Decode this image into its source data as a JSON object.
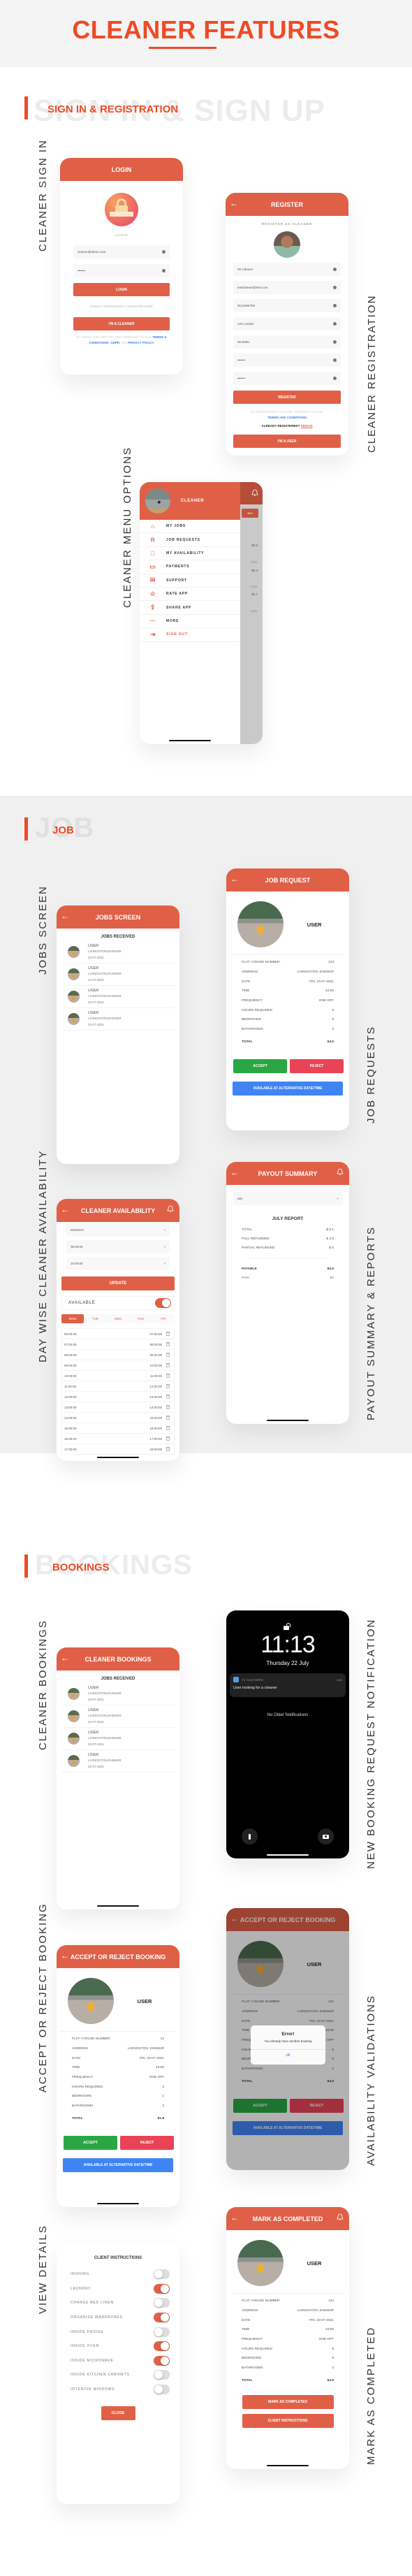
{
  "page": {
    "title": "CLEANER FEATURES"
  },
  "colors": {
    "accent": "#f04a25",
    "header": "#e06047",
    "accept": "#2aa744",
    "reject": "#ea4356",
    "alternative": "#3f84f5"
  },
  "sections": {
    "signin": {
      "label": "SIGN IN & REGISTRATION",
      "ghost": "SIGN IN & SIGN UP"
    },
    "job": {
      "label": "JOB",
      "ghost": "JOB"
    },
    "bookings": {
      "label": "BOOKINGS",
      "ghost": "BOOKINGS"
    }
  },
  "captions": {
    "signin": "CLEANER SIGN IN",
    "registration": "CLEANER REGISTRATION",
    "menu": "CLEANER MENU OPTIONS",
    "jobs_screen": "JOBS SCREEN",
    "job_requests": "JOB REQUESTS",
    "availability": "DAY WISE CLEANER AVAILABILITY",
    "payout": "PAYOUT SUMMARY & REPORTS",
    "bookings": "CLEANER BOOKINGS",
    "notification": "NEW BOOKING REQUEST NOTIFICATION",
    "accept_reject": "ACCEPT OR REJECT BOOKING",
    "validations": "AVAILABILITY VALIDATIONS",
    "view_details": "VIEW DETAILS",
    "mark_completed": "MARK AS COMPLETED"
  },
  "login": {
    "header": "LOGIN",
    "icon_label": "LOGIN",
    "email": "cleaner@demo.com",
    "password": "•••••••",
    "login_button": "LOGIN",
    "forgot": "FORGOT PASSWORD?",
    "separator": "|",
    "register_here": "REGISTER HERE",
    "cleaner_button": "I'M A CLEANER",
    "terms_prefix": "BY USING THIS APP YOU ARE AGREEING TO OUR",
    "terms_link": "TERMS & CONDITIONS",
    "gdpr_link": "GDPR",
    "and": "AND",
    "privacy_link": "PRIVACY POLICY"
  },
  "register": {
    "header": "REGISTER",
    "subtitle": "REGISTER AS CLEANER",
    "fields": [
      "Mr Cleaner",
      "testcleaner@test.com",
      "0123456789",
      "123 London",
      "W1306U",
      "•••••••",
      "•••••••"
    ],
    "register_button": "REGISTER",
    "terms_prefix": "BY REGISTERING YOU ARE AGREEING TO OUR",
    "terms_link": "TERMS AND CONDITIONS",
    "already": "ALREADY REGISTERED?",
    "signin_link": "SIGN IN",
    "user_button": "I'M A USER"
  },
  "menu": {
    "profile_name": "CLEANER",
    "items": [
      {
        "label": "MY JOBS",
        "icon": "home-icon"
      },
      {
        "label": "JOB REQUESTS",
        "icon": "bell-icon"
      },
      {
        "label": "MY AVAILABILITY",
        "icon": "calendar-icon"
      },
      {
        "label": "PAYMENTS",
        "icon": "wallet-icon"
      },
      {
        "label": "SUPPORT",
        "icon": "mail-icon"
      },
      {
        "label": "RATE APP",
        "icon": "star-icon"
      },
      {
        "label": "SHARE APP",
        "icon": "share-icon"
      },
      {
        "label": "MORE",
        "icon": "more-icon"
      },
      {
        "label": "SIGN OUT",
        "icon": "signout-icon"
      }
    ],
    "behind": {
      "tab": "ING",
      "prices": [
        "$4.5",
        "$5.4",
        "$2.7"
      ],
      "times": [
        "07:00",
        "07:00",
        "13:00"
      ]
    }
  },
  "jobs_screen": {
    "header": "JOBS SCREEN",
    "subtitle": "JOBS RECEIVED",
    "items": [
      {
        "name": "USER",
        "address": "LIVINGSTON,EH548JR",
        "date": "23-07-2021"
      },
      {
        "name": "USER",
        "address": "LIVINGSTON,EH548JR",
        "date": "22-07-2021"
      },
      {
        "name": "USER",
        "address": "LIVINGSTON,EH548JR",
        "date": "22-07-2021"
      },
      {
        "name": "USER",
        "address": "LIVINGSTON,EH548JR",
        "date": "22-07-2021"
      }
    ]
  },
  "job_request": {
    "header": "JOB REQUEST",
    "user": "USER",
    "rows": [
      {
        "label": "FLAT / HOUSE NUMBER.",
        "value": "123"
      },
      {
        "label": "ADDRESS",
        "value": "LIVINGSTON, EH548JR"
      },
      {
        "label": "DATE",
        "value": "FRI, 23-07-2021"
      },
      {
        "label": "TIME",
        "value": "10:00"
      },
      {
        "label": "FREQUENCY",
        "value": "ONE OFF"
      },
      {
        "label": "HOURS REQUIRED",
        "value": "5"
      },
      {
        "label": "BEDROOMS",
        "value": "8"
      },
      {
        "label": "BATHROOMS",
        "value": "3"
      }
    ],
    "total_label": "TOTAL",
    "total_value": "$4.5",
    "accept": "ACCEPT",
    "reject": "REJECT",
    "alternative": "AVAILABLE AT ALTERNATIVE DATE/TIME"
  },
  "availability": {
    "header": "CLEANER AVAILABILITY",
    "day_select": "MONDAY",
    "start_select": "06:00:00",
    "end_select": "18:00:00",
    "update_button": "UPDATE",
    "available_label": "AVAILABLE",
    "available_on": true,
    "days": [
      "MON",
      "TUE",
      "WED",
      "THU",
      "FRI"
    ],
    "active_day": "MON",
    "slots": [
      [
        "06:00:00",
        "07:00:00"
      ],
      [
        "07:00:00",
        "08:00:00"
      ],
      [
        "08:00:00",
        "09:00:00"
      ],
      [
        "09:00:00",
        "10:00:00"
      ],
      [
        "10:00:00",
        "11:00:00"
      ],
      [
        "11:00:00",
        "12:00:00"
      ],
      [
        "12:00:00",
        "13:00:00"
      ],
      [
        "13:00:00",
        "14:00:00"
      ],
      [
        "14:00:00",
        "15:00:00"
      ],
      [
        "15:00:00",
        "16:00:00"
      ],
      [
        "16:00:00",
        "17:00:00"
      ],
      [
        "17:00:00",
        "18:00:00"
      ]
    ]
  },
  "payout": {
    "header": "PAYOUT SUMMARY",
    "month_select": "July",
    "report_title": "JULY REPORT",
    "rows": [
      {
        "label": "TOTAL",
        "value": "$ 8.1"
      },
      {
        "label": "FULL REFUNDED",
        "value": "$ 3.6"
      },
      {
        "label": "PARTIAL REFUNDED",
        "value": "$ 0"
      }
    ],
    "payable_label": "PAYABLE",
    "payable_value": "$4.5",
    "paid_label": "PAID",
    "paid_value": "$0"
  },
  "bookings": {
    "header": "CLEANER BOOKINGS",
    "subtitle": "JOBS RECEIVED",
    "items": [
      {
        "name": "USER",
        "address": "LIVINGSTON,EH548JR",
        "date": "23-07-2021"
      },
      {
        "name": "USER",
        "address": "LIVINGSTON,EH548JR",
        "date": "22-07-2021"
      },
      {
        "name": "USER",
        "address": "LIVINGSTON,EH548JR",
        "date": "22-07-2021"
      },
      {
        "name": "USER",
        "address": "LIVINGSTON,EH548JR",
        "date": "22-07-2021"
      }
    ]
  },
  "lockscreen": {
    "time": "11:13",
    "date": "Thursday 22 July",
    "app_name": "V1 CLEANERS",
    "when": "now",
    "message": "User looking for a cleaner",
    "no_older": "No Older Notifications"
  },
  "accept_reject": {
    "header": "ACCEPT OR REJECT BOOKING",
    "user": "USER",
    "rows": [
      {
        "label": "FLAT / HOUSE NUMBER.",
        "value": "12"
      },
      {
        "label": "ADDRESS",
        "value": "LIVINGSTON, EH548JR"
      },
      {
        "label": "DATE",
        "value": "FRI, 23-07-2021"
      },
      {
        "label": "TIME",
        "value": "16:00"
      },
      {
        "label": "FREQUENCY",
        "value": "ONE OFF"
      },
      {
        "label": "HOURS REQUIRED",
        "value": "2"
      },
      {
        "label": "BEDROOMS",
        "value": "1"
      },
      {
        "label": "BATHROOMS",
        "value": "2"
      }
    ],
    "total_label": "TOTAL",
    "total_value": "$1.8",
    "accept": "ACCEPT",
    "reject": "REJECT",
    "alternative": "AVAILABLE AT ALTERNATIVE DATE/TIME"
  },
  "validation": {
    "header": "ACCEPT OR REJECT BOOKING",
    "user": "USER",
    "rows": [
      {
        "label": "FLAT / HOUSE NUMBER.",
        "value": "123"
      },
      {
        "label": "ADDRESS",
        "value": "LIVINGSTON, EH548JR"
      },
      {
        "label": "DATE",
        "value": "FRI, 23-07-2021"
      },
      {
        "label": "TIME",
        "value": "10:00"
      },
      {
        "label": "FREQUENCY",
        "value": "ONE OFF"
      },
      {
        "label": "HOURS REQUIRED",
        "value": "5"
      },
      {
        "label": "BEDROOMS",
        "value": "8"
      },
      {
        "label": "BATHROOMS",
        "value": "3"
      }
    ],
    "total_label": "TOTAL",
    "total_value": "$4.5",
    "accept": "ACCEPT",
    "reject": "REJECT",
    "alternative": "AVAILABLE AT ALTERNATIVE DATE/TIME",
    "dialog_title": "Error!",
    "dialog_message": "You already have another booking",
    "dialog_ok": "ok"
  },
  "instructions": {
    "title": "CLIENT INSTRUCTIONS",
    "items": [
      {
        "label": "IRONING",
        "on": false
      },
      {
        "label": "LAUNDRY",
        "on": true
      },
      {
        "label": "CHANGE BED LINEN",
        "on": false
      },
      {
        "label": "ORGANISE WARDROBES",
        "on": true
      },
      {
        "label": "INSIDE FRIDGE",
        "on": false
      },
      {
        "label": "INSIDE OVEN",
        "on": true
      },
      {
        "label": "INSIDE MICROWAVE",
        "on": true
      },
      {
        "label": "INSIDE KITCHEN CABINETS",
        "on": false
      },
      {
        "label": "INTERIOR WINDOWS",
        "on": false
      }
    ],
    "close": "CLOSE"
  },
  "mark_completed": {
    "header": "MARK AS COMPLETED",
    "user": "USER",
    "rows": [
      {
        "label": "FLAT / HOUSE NUMBER",
        "value": "123"
      },
      {
        "label": "ADDRESS",
        "value": "LIVINGSTON, EH548JR"
      },
      {
        "label": "DATE",
        "value": "FRI, 23-07-2021"
      },
      {
        "label": "TIME",
        "value": "10:00"
      },
      {
        "label": "FREQUENCY",
        "value": "ONE OFF"
      },
      {
        "label": "HOURS REQUIRED",
        "value": "5"
      },
      {
        "label": "BEDROOMS",
        "value": "8"
      },
      {
        "label": "BATHROOMS",
        "value": "3"
      }
    ],
    "total_label": "TOTAL",
    "total_value": "$4.5",
    "complete_button": "MARK AS COMPLETED",
    "instructions_button": "CLIENT INSTRUCTIONS"
  }
}
